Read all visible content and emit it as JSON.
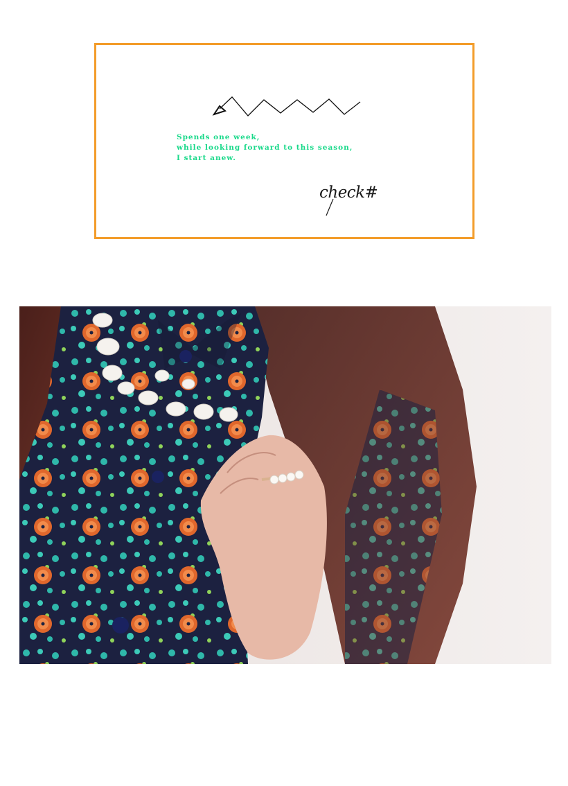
{
  "card": {
    "border_color": "#f39c2a",
    "tagline_color": "#19d98a",
    "tagline_lines": [
      "Spends one week,",
      "while looking forward to this season,",
      "I start anew."
    ],
    "signature": "check#"
  },
  "photo": {
    "icon": "floral-shirt-pearl-ring-photo"
  }
}
